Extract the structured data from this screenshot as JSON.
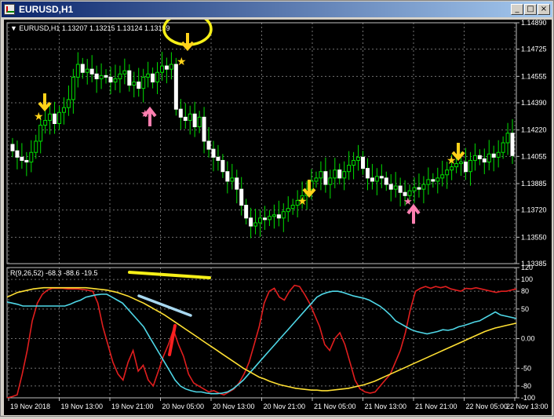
{
  "window": {
    "title": "EURUSD,H1",
    "buttons": [
      "_",
      "□",
      "×"
    ]
  },
  "chart_info": "▼ EURUSD,H1  1.13207 1.13215 1.13124 1.13159",
  "chart_data": [
    {
      "type": "candlestick",
      "symbol": "EURUSD",
      "timeframe": "H1",
      "ohlc_header": [
        1.13207,
        1.13215,
        1.13124,
        1.13159
      ],
      "y_ticks": [
        "1.14890",
        "1.14725",
        "1.14555",
        "1.14390",
        "1.14220",
        "1.14055",
        "1.13885",
        "1.13720",
        "1.13550",
        "1.13385"
      ],
      "ylim": [
        1.13385,
        1.1489
      ],
      "x_ticks": [
        "19 Nov 2018",
        "19 Nov 13:00",
        "19 Nov 21:00",
        "20 Nov 05:00",
        "20 Nov 13:00",
        "20 Nov 21:00",
        "21 Nov 05:00",
        "21 Nov 13:00",
        "21 Nov 21:00",
        "22 Nov 05:00",
        "22 Nov 13:00"
      ],
      "close": [
        1.1409,
        1.1405,
        1.1403,
        1.1402,
        1.1408,
        1.1415,
        1.1425,
        1.1428,
        1.1432,
        1.1426,
        1.1433,
        1.1436,
        1.1441,
        1.1455,
        1.1463,
        1.1458,
        1.146,
        1.1457,
        1.1454,
        1.1456,
        1.1455,
        1.1452,
        1.1454,
        1.1457,
        1.1459,
        1.145,
        1.1452,
        1.1448,
        1.1455,
        1.1457,
        1.1452,
        1.1458,
        1.1462,
        1.146,
        1.1463,
        1.1435,
        1.143,
        1.1428,
        1.1432,
        1.1424,
        1.143,
        1.1415,
        1.141,
        1.1405,
        1.1403,
        1.1396,
        1.139,
        1.1392,
        1.1385,
        1.1375,
        1.1367,
        1.1362,
        1.1364,
        1.1367,
        1.1366,
        1.1368,
        1.1369,
        1.1367,
        1.1371,
        1.1373,
        1.1375,
        1.1378,
        1.1381,
        1.1385,
        1.139,
        1.1392,
        1.1396,
        1.1388,
        1.1392,
        1.1397,
        1.1392,
        1.1396,
        1.14,
        1.1403,
        1.1405,
        1.1398,
        1.1392,
        1.139,
        1.1393,
        1.1392,
        1.1388,
        1.1385,
        1.1387,
        1.1383,
        1.1381,
        1.1384,
        1.1386,
        1.1385,
        1.1388,
        1.1391,
        1.139,
        1.1392,
        1.1394,
        1.1397,
        1.1399,
        1.1401,
        1.1402,
        1.1396,
        1.1403,
        1.1406,
        1.1404,
        1.1402,
        1.1407,
        1.1405,
        1.1408,
        1.1414,
        1.142,
        1.1406
      ],
      "annotations": [
        "down-arrow",
        "star",
        "up-arrow",
        "circle",
        "line"
      ]
    },
    {
      "type": "line",
      "indicator_label": "R(9,26,52) -68.3 -88.6 -19.5",
      "y_ticks": [
        "120",
        "100",
        "80",
        "50",
        "0.00",
        "-50",
        "-80",
        "-100"
      ],
      "ylim": [
        -100,
        120
      ],
      "series": [
        {
          "name": "",
          "color": "#e11e1e",
          "values": [
            -100,
            -98,
            -95,
            -60,
            -20,
            30,
            60,
            75,
            82,
            85,
            85,
            85,
            84,
            84,
            84,
            83,
            82,
            80,
            60,
            20,
            -10,
            -40,
            -60,
            -70,
            -40,
            -20,
            -55,
            -45,
            -70,
            -80,
            -55,
            -30,
            -10,
            15,
            -10,
            -30,
            -60,
            -75,
            -80,
            -85,
            -90,
            -88,
            -92,
            -95,
            -90,
            -85,
            -75,
            -60,
            -40,
            -10,
            20,
            60,
            80,
            85,
            70,
            65,
            80,
            90,
            88,
            75,
            60,
            40,
            20,
            -10,
            -20,
            0,
            10,
            -10,
            -40,
            -70,
            -85,
            -90,
            -92,
            -90,
            -80,
            -70,
            -60,
            -40,
            -20,
            10,
            50,
            80,
            85,
            88,
            85,
            88,
            86,
            88,
            84,
            82,
            80,
            85,
            84,
            86,
            84,
            82,
            80,
            78,
            80,
            80,
            82,
            84
          ]
        },
        {
          "name": "",
          "color": "#4fd8e8",
          "values": [
            62,
            60,
            58,
            55,
            55,
            55,
            55,
            55,
            55,
            55,
            55,
            55,
            58,
            62,
            65,
            70,
            72,
            74,
            75,
            75,
            70,
            65,
            60,
            50,
            40,
            30,
            20,
            5,
            -10,
            -25,
            -40,
            -55,
            -70,
            -80,
            -85,
            -88,
            -90,
            -90,
            -92,
            -93,
            -93,
            -92,
            -90,
            -85,
            -78,
            -70,
            -60,
            -50,
            -40,
            -30,
            -20,
            -10,
            0,
            10,
            20,
            30,
            40,
            50,
            60,
            70,
            75,
            78,
            80,
            80,
            78,
            75,
            72,
            70,
            68,
            65,
            60,
            55,
            48,
            40,
            30,
            25,
            20,
            15,
            12,
            10,
            8,
            10,
            12,
            15,
            14,
            16,
            20,
            22,
            25,
            28,
            30,
            35,
            40,
            45,
            40,
            38,
            36,
            34
          ]
        },
        {
          "name": "",
          "color": "#ffe033",
          "values": [
            70,
            74,
            78,
            80,
            82,
            84,
            85,
            86,
            86,
            86,
            86,
            86,
            86,
            86,
            86,
            86,
            85,
            84,
            83,
            82,
            80,
            78,
            75,
            72,
            68,
            64,
            60,
            55,
            50,
            45,
            40,
            34,
            28,
            22,
            16,
            10,
            4,
            -2,
            -8,
            -14,
            -20,
            -26,
            -32,
            -38,
            -44,
            -50,
            -55,
            -60,
            -65,
            -68,
            -72,
            -75,
            -78,
            -80,
            -82,
            -84,
            -85,
            -86,
            -87,
            -87,
            -88,
            -88,
            -87,
            -86,
            -85,
            -84,
            -82,
            -80,
            -78,
            -75,
            -72,
            -68,
            -64,
            -60,
            -56,
            -52,
            -48,
            -44,
            -40,
            -36,
            -32,
            -28,
            -24,
            -20,
            -16,
            -12,
            -8,
            -4,
            0,
            4,
            8,
            12,
            15,
            18,
            20,
            22,
            24,
            26
          ]
        }
      ]
    }
  ]
}
